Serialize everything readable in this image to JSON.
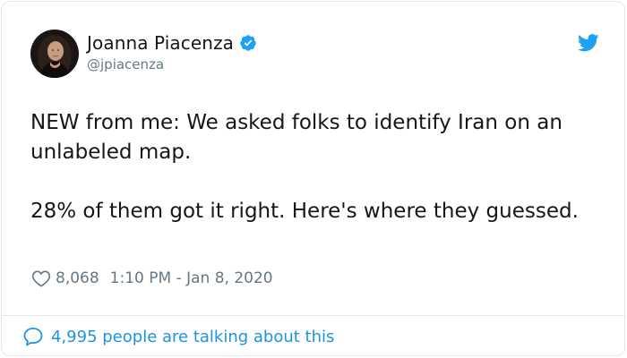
{
  "author": {
    "display_name": "Joanna Piacenza",
    "handle": "@jpiacenza",
    "verified": true,
    "avatar_icon": "profile-photo"
  },
  "tweet": {
    "paragraphs": [
      "NEW from me: We asked folks to identify Iran on an unlabeled map.",
      "28% of them got it right. Here's where they guessed."
    ]
  },
  "meta": {
    "likes": "8,068",
    "timestamp": "1:10 PM - Jan 8, 2020"
  },
  "footer": {
    "talking_text": "4,995 people are talking about this"
  },
  "colors": {
    "brand_blue": "#1da1f2",
    "link_blue": "#1b95e0",
    "muted": "#657786",
    "border": "#e1e8ed"
  },
  "icons": {
    "bird": "twitter-bird-icon",
    "verified": "verified-badge-icon",
    "heart": "heart-icon",
    "bubble": "speech-bubble-icon"
  }
}
